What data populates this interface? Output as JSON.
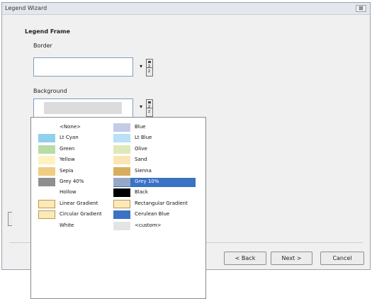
{
  "window": {
    "title": "Legend Wizard",
    "close_glyph": "⊠"
  },
  "frame": {
    "section_label": "Legend Frame",
    "border_label": "Border",
    "background_label": "Background",
    "dropdown_glyph": "▾"
  },
  "buttons": {
    "back": "< Back",
    "next": "Next >",
    "cancel": "Cancel"
  },
  "color_palette": {
    "items": [
      {
        "label": "<None>",
        "color": "#ffffff",
        "icon": "none"
      },
      {
        "label": "Blue",
        "color": "#c3cbe6"
      },
      {
        "label": "Lt Cyan",
        "color": "#8fd0ee"
      },
      {
        "label": "Lt Blue",
        "color": "#b9e0f6"
      },
      {
        "label": "Green",
        "color": "#b8dca5"
      },
      {
        "label": "Olive",
        "color": "#dfe8b8"
      },
      {
        "label": "Yellow",
        "color": "#fdf3c0"
      },
      {
        "label": "Sand",
        "color": "#fbe5b4"
      },
      {
        "label": "Sepia",
        "color": "#efcd82"
      },
      {
        "label": "Sienna",
        "color": "#d7ad5f"
      },
      {
        "label": "Grey 40%",
        "color": "#8f8f8f"
      },
      {
        "label": "Grey 10%",
        "color": "#96a8c8",
        "selected": true
      },
      {
        "label": "Hollow",
        "color": "#ffffff",
        "icon": "none"
      },
      {
        "label": "Black",
        "color": "#000000"
      },
      {
        "label": "Linear Gradient",
        "color": "#fde9b8",
        "icon": "gradient-box"
      },
      {
        "label": "Rectangular Gradient",
        "color": "#fde9b8",
        "icon": "gradient-box"
      },
      {
        "label": "Circular Gradient",
        "color": "#fde9b8",
        "icon": "gradient-box"
      },
      {
        "label": "Cerulean Blue",
        "color": "#3a72c4"
      },
      {
        "label": "White",
        "color": "#ffffff",
        "icon": "none"
      },
      {
        "label": "<custom>",
        "color": "#e4e4e4"
      }
    ]
  }
}
